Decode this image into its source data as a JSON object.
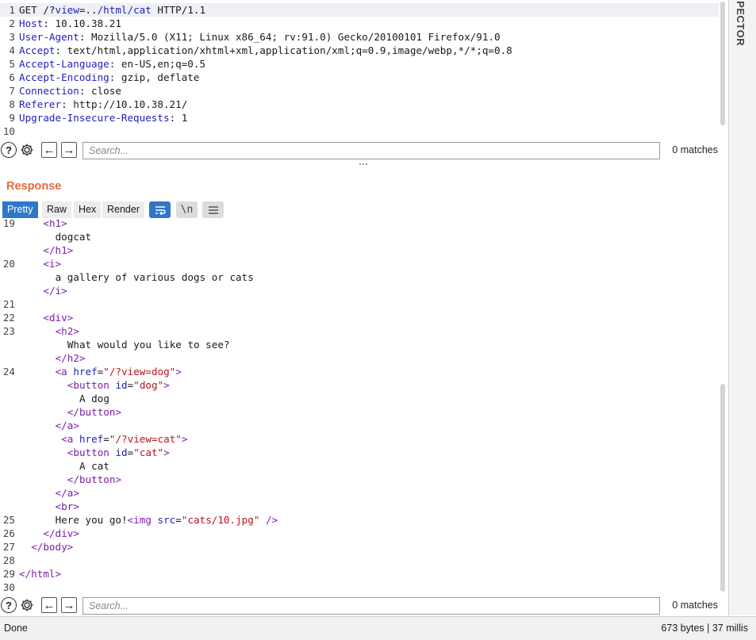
{
  "request": {
    "lines": [
      {
        "num": "1",
        "parts": [
          {
            "t": "GET /?",
            "c": ""
          },
          {
            "t": "view",
            "c": "path"
          },
          {
            "t": "=..",
            "c": ""
          },
          {
            "t": "/html/cat",
            "c": "path"
          },
          {
            "t": " HTTP/1.1",
            "c": ""
          }
        ]
      },
      {
        "num": "2",
        "parts": [
          {
            "t": "Host",
            "c": "hname"
          },
          {
            "t": ": 10.10.38.21",
            "c": ""
          }
        ]
      },
      {
        "num": "3",
        "parts": [
          {
            "t": "User-Agent",
            "c": "hname"
          },
          {
            "t": ": Mozilla/5.0 (X11; Linux x86_64; rv:91.0) Gecko/20100101 Firefox/91.0",
            "c": ""
          }
        ]
      },
      {
        "num": "4",
        "parts": [
          {
            "t": "Accept",
            "c": "hname"
          },
          {
            "t": ": text/html,application/xhtml+xml,application/xml;q=0.9,image/webp,*/*;q=0.8",
            "c": ""
          }
        ]
      },
      {
        "num": "5",
        "parts": [
          {
            "t": "Accept-Language",
            "c": "hname"
          },
          {
            "t": ": en-US,en;q=0.5",
            "c": ""
          }
        ]
      },
      {
        "num": "6",
        "parts": [
          {
            "t": "Accept-Encoding",
            "c": "hname"
          },
          {
            "t": ": gzip, deflate",
            "c": ""
          }
        ]
      },
      {
        "num": "7",
        "parts": [
          {
            "t": "Connection",
            "c": "hname"
          },
          {
            "t": ": close",
            "c": ""
          }
        ]
      },
      {
        "num": "8",
        "parts": [
          {
            "t": "Referer",
            "c": "hname"
          },
          {
            "t": ": http://10.10.38.21/",
            "c": ""
          }
        ]
      },
      {
        "num": "9",
        "parts": [
          {
            "t": "Upgrade-Insecure-Requests",
            "c": "hname"
          },
          {
            "t": ": 1",
            "c": ""
          }
        ]
      },
      {
        "num": "10",
        "parts": []
      }
    ]
  },
  "search_top": {
    "placeholder": "Search...",
    "matches": "0 matches"
  },
  "search_bottom": {
    "placeholder": "Search...",
    "matches": "0 matches"
  },
  "response": {
    "title": "Response",
    "tabs": [
      "Pretty",
      "Raw",
      "Hex",
      "Render"
    ],
    "active_tab": "Pretty",
    "wrap_icon": "wrap-lines-icon",
    "newline_label": "\\n",
    "menu_icon": "hamburger-menu-icon",
    "lines": [
      {
        "num": "19",
        "indent": 4,
        "parts": [
          {
            "t": "<h1>",
            "c": "tag"
          }
        ]
      },
      {
        "num": "",
        "indent": 6,
        "parts": [
          {
            "t": "dogcat",
            "c": ""
          }
        ]
      },
      {
        "num": "",
        "indent": 4,
        "parts": [
          {
            "t": "</h1>",
            "c": "tag"
          }
        ]
      },
      {
        "num": "20",
        "indent": 4,
        "parts": [
          {
            "t": "<i>",
            "c": "tag"
          }
        ]
      },
      {
        "num": "",
        "indent": 6,
        "parts": [
          {
            "t": "a gallery of various dogs or cats",
            "c": ""
          }
        ]
      },
      {
        "num": "",
        "indent": 4,
        "parts": [
          {
            "t": "</i>",
            "c": "tag"
          }
        ]
      },
      {
        "num": "21",
        "indent": 0,
        "parts": []
      },
      {
        "num": "22",
        "indent": 4,
        "parts": [
          {
            "t": "<div>",
            "c": "tag"
          }
        ]
      },
      {
        "num": "23",
        "indent": 6,
        "parts": [
          {
            "t": "<h2>",
            "c": "tag"
          }
        ]
      },
      {
        "num": "",
        "indent": 8,
        "parts": [
          {
            "t": "What would you like to see?",
            "c": ""
          }
        ]
      },
      {
        "num": "",
        "indent": 6,
        "parts": [
          {
            "t": "</h2>",
            "c": "tag"
          }
        ]
      },
      {
        "num": "24",
        "indent": 6,
        "parts": [
          {
            "t": "<a ",
            "c": "tag"
          },
          {
            "t": "href",
            "c": "attr"
          },
          {
            "t": "=",
            "c": ""
          },
          {
            "t": "\"/?view=dog\"",
            "c": "val"
          },
          {
            "t": ">",
            "c": "tag"
          }
        ]
      },
      {
        "num": "",
        "indent": 8,
        "parts": [
          {
            "t": "<button ",
            "c": "tag"
          },
          {
            "t": "id",
            "c": "attr"
          },
          {
            "t": "=",
            "c": ""
          },
          {
            "t": "\"dog\"",
            "c": "val"
          },
          {
            "t": ">",
            "c": "tag"
          }
        ]
      },
      {
        "num": "",
        "indent": 10,
        "parts": [
          {
            "t": "A dog",
            "c": ""
          }
        ]
      },
      {
        "num": "",
        "indent": 8,
        "parts": [
          {
            "t": "</button>",
            "c": "tag"
          }
        ]
      },
      {
        "num": "",
        "indent": 6,
        "parts": [
          {
            "t": "</a>",
            "c": "tag"
          }
        ]
      },
      {
        "num": "",
        "indent": 7,
        "parts": [
          {
            "t": "<a ",
            "c": "tag"
          },
          {
            "t": "href",
            "c": "attr"
          },
          {
            "t": "=",
            "c": ""
          },
          {
            "t": "\"/?view=cat\"",
            "c": "val"
          },
          {
            "t": ">",
            "c": "tag"
          }
        ]
      },
      {
        "num": "",
        "indent": 8,
        "parts": [
          {
            "t": "<button ",
            "c": "tag"
          },
          {
            "t": "id",
            "c": "attr"
          },
          {
            "t": "=",
            "c": ""
          },
          {
            "t": "\"cat\"",
            "c": "val"
          },
          {
            "t": ">",
            "c": "tag"
          }
        ]
      },
      {
        "num": "",
        "indent": 10,
        "parts": [
          {
            "t": "A cat",
            "c": ""
          }
        ]
      },
      {
        "num": "",
        "indent": 8,
        "parts": [
          {
            "t": "</button>",
            "c": "tag"
          }
        ]
      },
      {
        "num": "",
        "indent": 6,
        "parts": [
          {
            "t": "</a>",
            "c": "tag"
          }
        ]
      },
      {
        "num": "",
        "indent": 6,
        "parts": [
          {
            "t": "<br>",
            "c": "tag"
          }
        ]
      },
      {
        "num": "25",
        "indent": 6,
        "parts": [
          {
            "t": "Here you go!",
            "c": ""
          },
          {
            "t": "<img ",
            "c": "tag"
          },
          {
            "t": "src",
            "c": "attr"
          },
          {
            "t": "=",
            "c": ""
          },
          {
            "t": "\"cats/10.jpg\"",
            "c": "val"
          },
          {
            "t": " />",
            "c": "tag"
          }
        ]
      },
      {
        "num": "26",
        "indent": 4,
        "parts": [
          {
            "t": "</div>",
            "c": "tag"
          }
        ]
      },
      {
        "num": "27",
        "indent": 2,
        "parts": [
          {
            "t": "</body>",
            "c": "tag"
          }
        ]
      },
      {
        "num": "28",
        "indent": 0,
        "parts": []
      },
      {
        "num": "29",
        "indent": 0,
        "parts": [
          {
            "t": "</html>",
            "c": "tag"
          }
        ]
      },
      {
        "num": "30",
        "indent": 0,
        "parts": []
      }
    ]
  },
  "side_panel": {
    "label": "SPECTOR"
  },
  "status": {
    "left": "Done",
    "right": "673 bytes | 37 millis"
  },
  "colors": {
    "accent": "#2f77c9",
    "response_title": "#e8673a",
    "tag": "#7a1fa6",
    "attr": "#1f1fb8",
    "value": "#b5161d"
  }
}
